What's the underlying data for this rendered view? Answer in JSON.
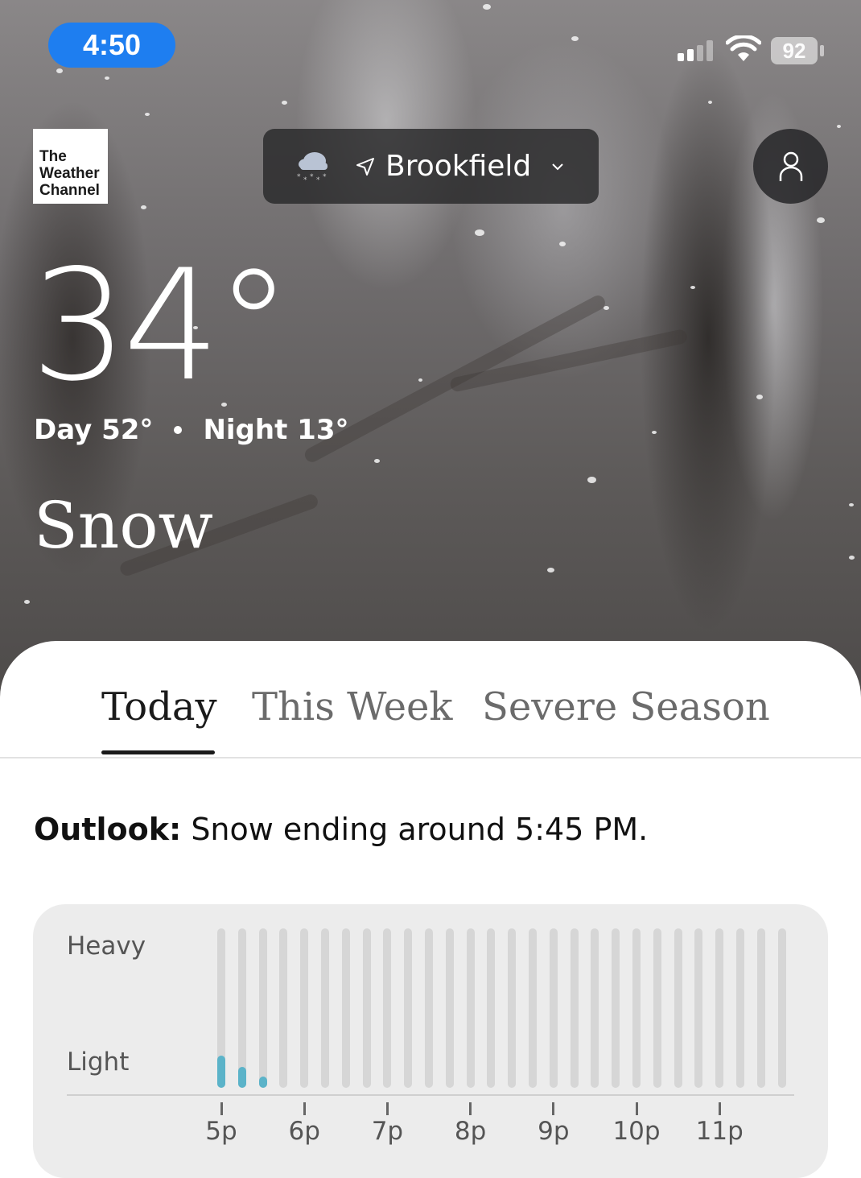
{
  "status_bar": {
    "time": "4:50",
    "battery": "92"
  },
  "header": {
    "logo_lines": [
      "The",
      "Weather",
      "Channel"
    ],
    "location": "Brookfield",
    "weather_icon": "snow-cloud-icon",
    "location_icon": "location-arrow-icon",
    "dropdown_icon": "chevron-down-icon",
    "profile_icon": "person-icon"
  },
  "current": {
    "temperature": "34°",
    "day_label": "Day 52°",
    "night_label": "Night 13°",
    "condition": "Snow"
  },
  "tabs": [
    {
      "label": "Today",
      "active": true
    },
    {
      "label": "This Week",
      "active": false
    },
    {
      "label": "Severe Season",
      "active": false
    }
  ],
  "outlook": {
    "label": "Outlook:",
    "text": " Snow ending around 5:45 PM."
  },
  "colors": {
    "accent_blue": "#1e7ef0",
    "precip_bar": "#5bb3c9",
    "bar_track": "#d6d6d6"
  },
  "chart_data": {
    "type": "bar",
    "y_labels": [
      "Heavy",
      "Light"
    ],
    "x_tick_labels": [
      "5p",
      "6p",
      "7p",
      "8p",
      "9p",
      "10p",
      "11p"
    ],
    "interval_minutes": 15,
    "intensity_scale": {
      "light": 1.0,
      "heavy": 2.0
    },
    "series": [
      {
        "values": [
          0.5,
          0.33,
          0.1,
          0,
          0,
          0,
          0,
          0,
          0,
          0,
          0,
          0,
          0,
          0,
          0,
          0,
          0,
          0,
          0,
          0,
          0,
          0,
          0,
          0,
          0,
          0,
          0,
          0
        ]
      }
    ]
  }
}
